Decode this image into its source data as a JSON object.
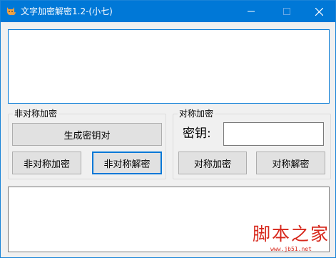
{
  "window": {
    "title": "文字加密解密1.2-(小七)",
    "icon": "cat-icon",
    "controls": [
      "minimize-icon",
      "maximize-icon",
      "close-icon"
    ],
    "accent_color": "#0078d7"
  },
  "input_text": {
    "value": ""
  },
  "output_text": {
    "value": ""
  },
  "asymmetric": {
    "group_label": "非对称加密",
    "generate_keypair_label": "生成密钥对",
    "encrypt_label": "非对称加密",
    "decrypt_label": "非对称解密"
  },
  "symmetric": {
    "group_label": "对称加密",
    "key_label": "密钥:",
    "key_value": "",
    "encrypt_label": "对称加密",
    "decrypt_label": "对称解密"
  },
  "watermark": {
    "title": "脚本之家",
    "url": "www.jb51.net"
  }
}
